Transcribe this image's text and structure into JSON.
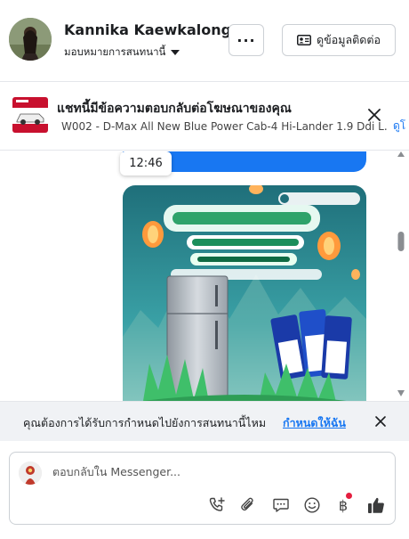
{
  "header": {
    "name": "Kannika Kaewkalong",
    "assign_label": "มอบหมายการสนทนานี้",
    "more_label": "···",
    "contact_label": "ดูข้อมูลติดต่อ"
  },
  "ad": {
    "title": "แชทนี้มีข้อความตอบกลับต่อโฆษณาของคุณ",
    "subtitle": "W002 - D-Max All New Blue Power Cab-4 Hi-Lander 1.9 Ddi L...",
    "link": "ดูโ"
  },
  "chat": {
    "timestamp": "12:46"
  },
  "assign_prompt": {
    "text": "คุณต้องการได้รับการกำหนดไปยังการสนทนานี้ไหม",
    "link": "กำหนดให้ฉัน"
  },
  "reply": {
    "placeholder": "ตอบกลับใน Messenger..."
  },
  "colors": {
    "accent": "#1877f2",
    "notification": "#e41e3f"
  }
}
